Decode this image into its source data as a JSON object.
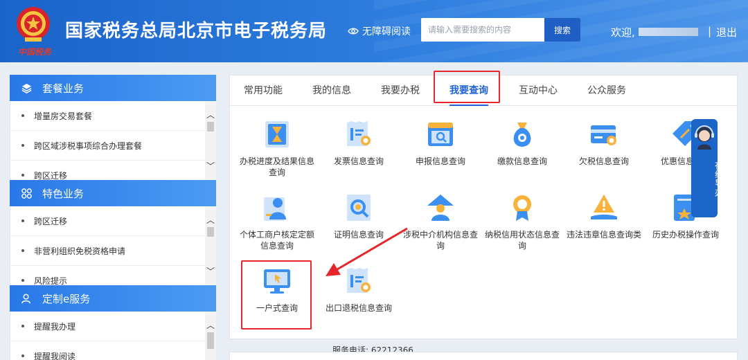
{
  "header": {
    "emblem_sign": "中国税务",
    "title": "国家税务总局北京市电子税务局",
    "accessibility_label": "无障碍阅读",
    "search_placeholder": "请输入需要搜索的内容",
    "search_button": "搜索",
    "welcome": "欢迎,",
    "divider": "|",
    "logout": "退出"
  },
  "sidebar": {
    "sections": [
      {
        "title": "套餐业务",
        "icon": "layers-icon",
        "items": [
          "增量房交易套餐",
          "跨区域涉税事项综合办理套餐",
          "跨区迁移"
        ]
      },
      {
        "title": "特色业务",
        "icon": "grid-icon",
        "items": [
          "跨区迁移",
          "非营利组织免税资格申请",
          "风险提示"
        ]
      },
      {
        "title": "定制e服务",
        "icon": "user-icon",
        "items": [
          "提醒我办理",
          "提醒我阅读"
        ]
      }
    ]
  },
  "tabs": [
    "常用功能",
    "我的信息",
    "我要办税",
    "我要查询",
    "互动中心",
    "公众服务"
  ],
  "active_tab": "我要查询",
  "tiles": [
    {
      "label": "办税进度及结果信息查询",
      "icon": "hourglass-icon"
    },
    {
      "label": "发票信息查询",
      "icon": "invoice-search-icon"
    },
    {
      "label": "申报信息查询",
      "icon": "declaration-search-icon"
    },
    {
      "label": "缴款信息查询",
      "icon": "money-bag-icon"
    },
    {
      "label": "欠税信息查询",
      "icon": "card-search-icon"
    },
    {
      "label": "优惠信息查询",
      "icon": "discount-tag-icon"
    },
    {
      "label": "个体工商户核定定额信息查询",
      "icon": "individual-business-icon"
    },
    {
      "label": "证明信息查询",
      "icon": "certificate-search-icon"
    },
    {
      "label": "涉税中介机构信息查询",
      "icon": "agency-icon"
    },
    {
      "label": "纳税信用状态信息查询",
      "icon": "credit-medal-icon"
    },
    {
      "label": "违法违章信息查询类",
      "icon": "warning-icon"
    },
    {
      "label": "历史办税操作查询",
      "icon": "history-icon"
    },
    {
      "label": "一户式查询",
      "icon": "monitor-cursor-icon"
    },
    {
      "label": "出口退税信息查询",
      "icon": "export-refund-icon"
    }
  ],
  "service_phone": "服务电话: 62212366",
  "guide": {
    "label": "在线导办"
  },
  "colors": {
    "header_blue": "#1a63c9",
    "accent": "#1f63d4",
    "highlight_red": "#e5262a"
  }
}
